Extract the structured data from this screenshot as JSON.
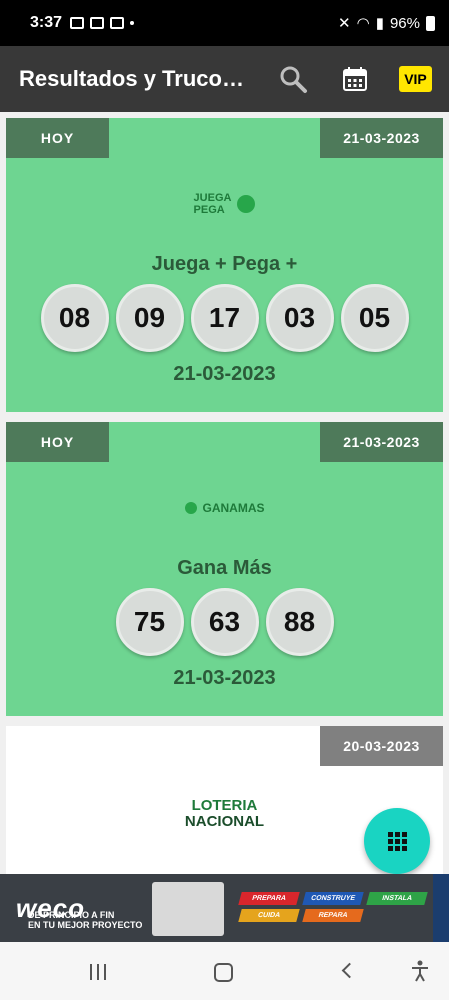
{
  "status_bar": {
    "time": "3:37",
    "battery": "96%"
  },
  "app_bar": {
    "title": "Resultados y Truco…",
    "vip_label": "VIP"
  },
  "cards": [
    {
      "tag_left": "HOY",
      "tag_right": "21-03-2023",
      "logo_text_1": "JUEGA",
      "logo_text_2": "PEGA",
      "name": "Juega + Pega +",
      "numbers": [
        "08",
        "09",
        "17",
        "03",
        "05"
      ],
      "date": "21-03-2023"
    },
    {
      "tag_left": "HOY",
      "tag_right": "21-03-2023",
      "logo_text_1": "GANAMAS",
      "name": "Gana Más",
      "numbers": [
        "75",
        "63",
        "88"
      ],
      "date": "21-03-2023"
    },
    {
      "tag_right": "20-03-2023",
      "logo_text_1": "LOTERIA",
      "logo_text_2": "NACIONAL"
    }
  ],
  "ad": {
    "brand": "weco",
    "slogan_1": "DE PRINCIPIO A FIN",
    "slogan_2": "EN TU MEJOR PROYECTO",
    "tags": [
      "PREPARA",
      "CONSTRUYE",
      "INSTALA",
      "CUIDA",
      "REPARA"
    ],
    "colors": {
      "prepara": "#d9262c",
      "construye": "#1f58b4",
      "instala": "#2ea347",
      "cuida": "#e5a41d",
      "repara": "#e56a1d"
    }
  }
}
